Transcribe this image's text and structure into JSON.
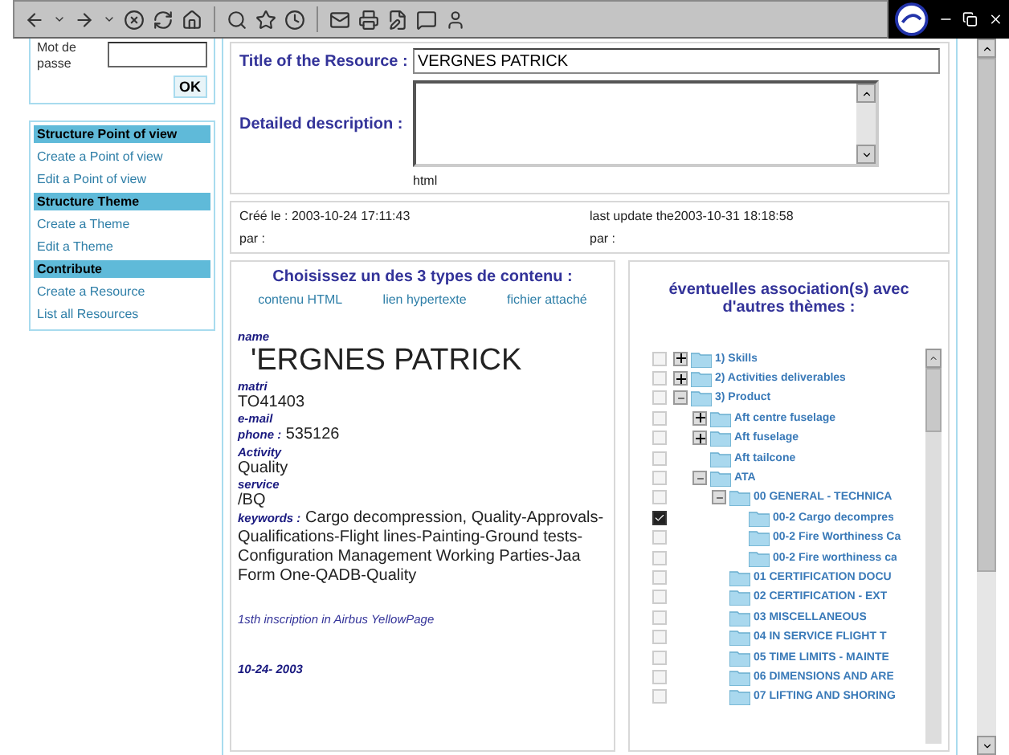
{
  "login": {
    "password_label": "Mot de passe",
    "ok_button": "OK"
  },
  "nav": [
    {
      "kind": "header",
      "label": "Structure Point of view"
    },
    {
      "kind": "link",
      "label": "Create a Point of view"
    },
    {
      "kind": "link",
      "label": "Edit a Point of view"
    },
    {
      "kind": "header",
      "label": "Structure Theme"
    },
    {
      "kind": "link",
      "label": "Create a Theme"
    },
    {
      "kind": "link",
      "label": "Edit a Theme"
    },
    {
      "kind": "header",
      "label": "Contribute"
    },
    {
      "kind": "link",
      "label": "Create a Resource"
    },
    {
      "kind": "link",
      "label": "List all Resources"
    }
  ],
  "resource": {
    "title_label": "Title of the Resource :",
    "title_value": "VERGNES PATRICK",
    "description_label": "Detailed description :",
    "format_note": "html"
  },
  "meta": {
    "created": "Créé le : 2003-10-24 17:11:43",
    "created_by": "par :",
    "updated": "last update the2003-10-31 18:18:58",
    "updated_by": "par :"
  },
  "content": {
    "heading": "Choisissez un des 3 types de contenu :",
    "types": [
      "contenu HTML",
      "lien hypertexte",
      "fichier attaché"
    ],
    "fields": [
      {
        "kind": "block",
        "label": "name",
        "value": "'ERGNES PATRICK",
        "big": true
      },
      {
        "kind": "block",
        "label": "matri",
        "value": "TO41403"
      },
      {
        "kind": "block",
        "label": "e-mail"
      },
      {
        "kind": "inline",
        "label": "phone :",
        "value": "535126"
      },
      {
        "kind": "block",
        "label": "Activity",
        "value": " Quality"
      },
      {
        "kind": "block",
        "label": "service",
        "value": "/BQ"
      },
      {
        "kind": "inline",
        "label": "keywords :",
        "value": "Cargo decompression, Quality-Approvals-Qualifications-Flight lines-Painting-Ground tests-Configuration Management Working Parties-Jaa Form One-QADB-Quality"
      }
    ],
    "note": "1sth inscription in Airbus YellowPage",
    "date": "10-24- 2003"
  },
  "associations": {
    "heading": "éventuelles association(s) avec d'autres thèmes :",
    "tree": [
      {
        "label": "1) Skills",
        "checked": false,
        "expanded": false
      },
      {
        "label": "2) Activities deliverables",
        "checked": false,
        "expanded": false
      },
      {
        "label": "3) Product",
        "checked": false,
        "expanded": true,
        "children": [
          {
            "label": "Aft centre fuselage",
            "checked": false,
            "expanded": false
          },
          {
            "label": "Aft fuselage",
            "checked": false,
            "expanded": false
          },
          {
            "label": "Aft tailcone",
            "checked": false
          },
          {
            "label": "ATA",
            "checked": false,
            "expanded": true,
            "children": [
              {
                "label": "00 GENERAL - TECHNICA",
                "checked": false,
                "expanded": true,
                "children": [
                  {
                    "label": "00-2 Cargo decompres",
                    "checked": true
                  },
                  {
                    "label": "00-2 Fire Worthiness Ca",
                    "checked": false
                  },
                  {
                    "label": "00-2 Fire worthiness ca",
                    "checked": false
                  }
                ]
              },
              {
                "label": "01 CERTIFICATION DOCU",
                "checked": false
              },
              {
                "label": "02 CERTIFICATION - EXT",
                "checked": false
              },
              {
                "label": "03 MISCELLANEOUS",
                "checked": false
              },
              {
                "label": "04 IN SERVICE FLIGHT T",
                "checked": false
              },
              {
                "label": "05 TIME LIMITS - MAINTE",
                "checked": false
              },
              {
                "label": "06 DIMENSIONS AND ARE",
                "checked": false
              },
              {
                "label": "07 LIFTING AND SHORING",
                "checked": false
              }
            ]
          }
        ]
      }
    ]
  }
}
